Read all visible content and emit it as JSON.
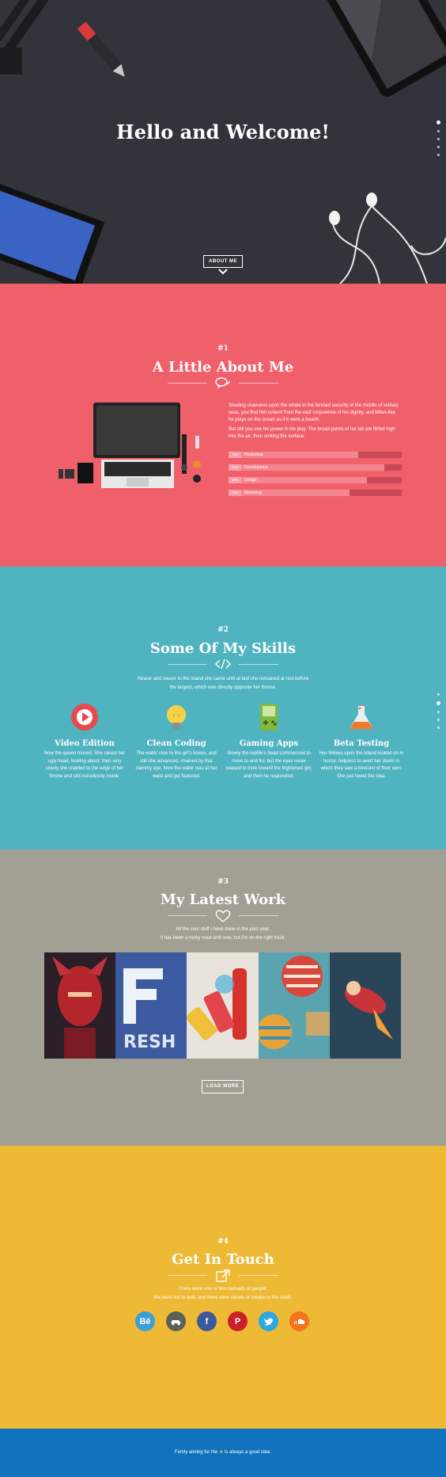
{
  "hero": {
    "title": "Hello and Welcome!",
    "button": "ABOUT ME"
  },
  "about": {
    "number": "#1",
    "title": "A Little About Me",
    "paragraph1": "Stealing unawares upon the whale in the fancied security of the middle of solitary seas, you find him unbent from the vast corpulence of his dignity, and kitten-like, he plays on the ocean as if it were a hearth.",
    "paragraph2": "But still you see his power in his play. The broad palms of his tail are flirted high into the air; then smiting the surface.",
    "skills": [
      {
        "label": "Photoshop",
        "pct": "75%",
        "value": 75
      },
      {
        "label": "Development",
        "pct": "90%",
        "value": 90
      },
      {
        "label": "Design",
        "pct": "80%",
        "value": 80
      },
      {
        "label": "Marketing",
        "pct": "70%",
        "value": 70
      }
    ]
  },
  "skills": {
    "number": "#2",
    "title": "Some Of My Skills",
    "intro_line1": "Nearer and nearer to the island she came until at last she remained at rest before",
    "intro_line2": "the largest, which was directly opposite her throne.",
    "items": [
      {
        "title": "Video Edition",
        "icon": "play-icon",
        "text": "Now the queen moved. She raised her ugly head, looking about; then very slowly she crawled to the edge of her throne and slid noiselessly inside."
      },
      {
        "title": "Clean Coding",
        "icon": "lightbulb-icon",
        "text": "The water rose to the girl's knees, and still she advanced, chained by that clammy eye. Now the water was at her waist and got featured."
      },
      {
        "title": "Gaming Apps",
        "icon": "gameboy-icon",
        "text": "Slowly the reptile's head commenced to move to and fro, but the eyes never ceased to bore toward the frightened girl, and then he responded."
      },
      {
        "title": "Beta Testing",
        "icon": "flask-icon",
        "text": "Her fellows upon the island looked on in horror, helpless to avert her doom in which they saw a forecast of their own. She just loved the idea."
      }
    ]
  },
  "work": {
    "number": "#3",
    "title": "My Latest Work",
    "intro_line1": "All the cool stuff I have done in the past year.",
    "intro_line2": "It has been a rocky road until now, but I'm on the right track.",
    "button": "LOAD MORE"
  },
  "contact": {
    "number": "#4",
    "title": "Get In Touch",
    "intro_line1": "There were one or two carloads of people.",
    "intro_line2": "We went out to look, and there were clouds of smoke to the south.",
    "socials": [
      {
        "name": "behance",
        "label": "Bē",
        "color": "#3b9fd6"
      },
      {
        "name": "car",
        "label": "",
        "color": "#5a6157"
      },
      {
        "name": "facebook",
        "label": "f",
        "color": "#3c5a9a"
      },
      {
        "name": "pinterest",
        "label": "P",
        "color": "#cb2027"
      },
      {
        "name": "twitter",
        "label": "",
        "color": "#2aa9e0"
      },
      {
        "name": "soundcloud",
        "label": "",
        "color": "#f5731f"
      }
    ]
  },
  "footer": {
    "before": "Firmly aiming for the",
    "after": "is always a good idea."
  },
  "colors": {
    "hero": "#33343b",
    "about": "#f0606b",
    "skills": "#50b3c0",
    "work": "#a29f94",
    "contact": "#eeb935",
    "footer": "#1072bc"
  }
}
